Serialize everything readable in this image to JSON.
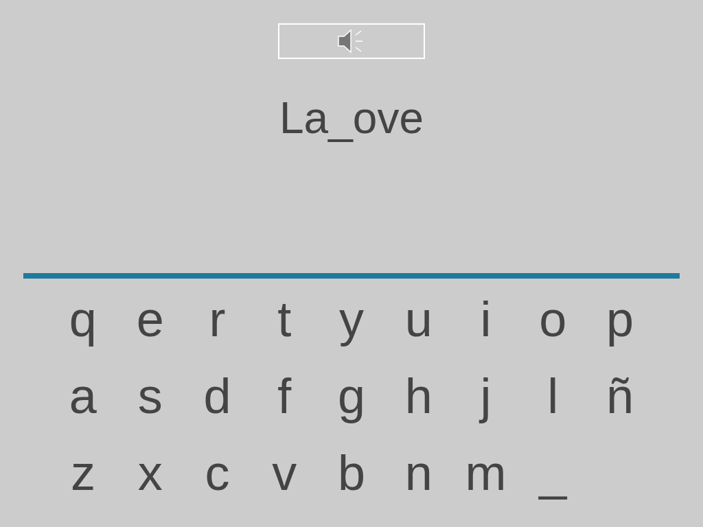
{
  "word": "La_ove",
  "keyboard": {
    "rows": [
      [
        "q",
        "e",
        "r",
        "t",
        "y",
        "u",
        "i",
        "o",
        "p"
      ],
      [
        "a",
        "s",
        "d",
        "f",
        "g",
        "h",
        "j",
        "l",
        "ñ"
      ],
      [
        "z",
        "x",
        "c",
        "v",
        "b",
        "n",
        "m",
        "_"
      ]
    ]
  }
}
